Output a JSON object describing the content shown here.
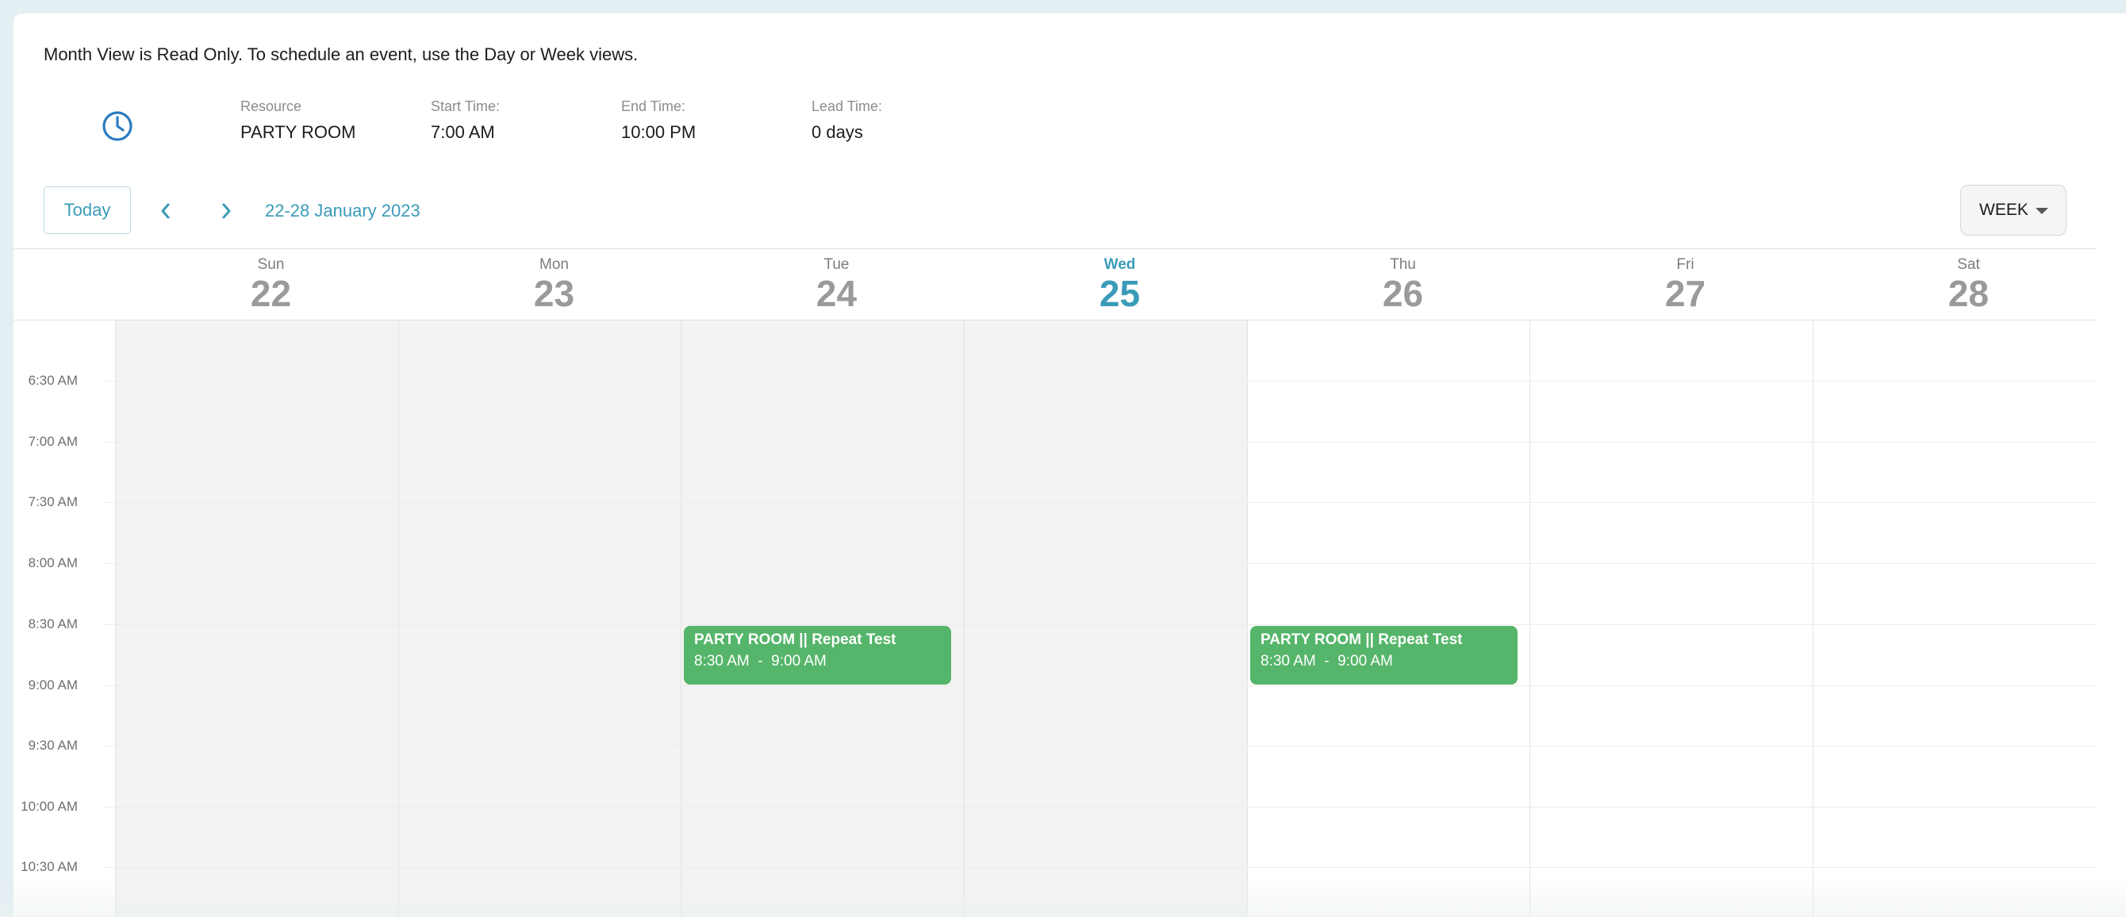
{
  "notice": "Month View is Read Only. To schedule an event, use the Day or Week views.",
  "info": {
    "icon": "clock-icon",
    "resource": {
      "label": "Resource",
      "value": "PARTY ROOM"
    },
    "start_time": {
      "label": "Start Time:",
      "value": "7:00 AM"
    },
    "end_time": {
      "label": "End Time:",
      "value": "10:00 PM"
    },
    "lead_time": {
      "label": "Lead Time:",
      "value": "0 days"
    }
  },
  "toolbar": {
    "today_label": "Today",
    "prev_icon": "chevron-left-icon",
    "next_icon": "chevron-right-icon",
    "range_label": "22-28 January 2023",
    "view_select": "WEEK"
  },
  "days": [
    {
      "name": "Sun",
      "date": "22"
    },
    {
      "name": "Mon",
      "date": "23"
    },
    {
      "name": "Tue",
      "date": "24"
    },
    {
      "name": "Wed",
      "date": "25"
    },
    {
      "name": "Thu",
      "date": "26"
    },
    {
      "name": "Fri",
      "date": "27"
    },
    {
      "name": "Sat",
      "date": "28"
    }
  ],
  "times": [
    "6:30 AM",
    "7:00 AM",
    "7:30 AM",
    "8:00 AM",
    "8:30 AM",
    "9:00 AM",
    "9:30 AM",
    "10:00 AM",
    "10:30 AM"
  ],
  "events": [
    {
      "title": "PARTY ROOM || Repeat Test",
      "time": "8:30 AM  -  9:00 AM"
    },
    {
      "title": "PARTY ROOM || Repeat Test",
      "time": "8:30 AM  -  9:00 AM"
    }
  ],
  "colors": {
    "accent": "#3a9bb8",
    "event": "#55b56a",
    "past_day": "#f3f3f3"
  }
}
